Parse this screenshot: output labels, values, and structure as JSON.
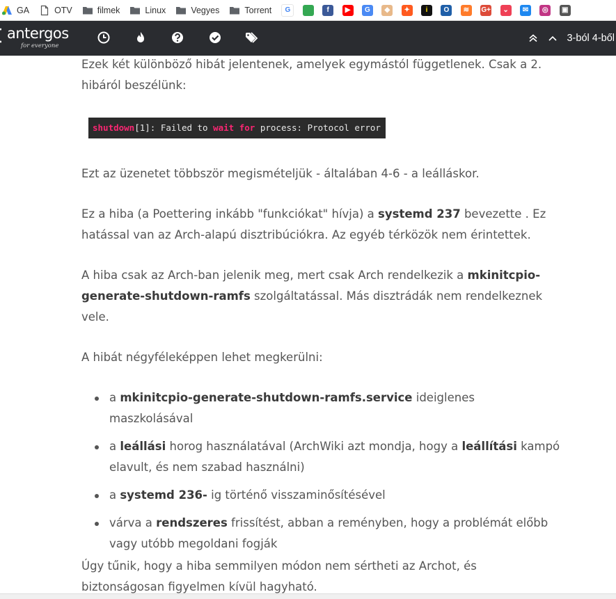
{
  "bookmarks": {
    "folders": [
      {
        "label": "GA",
        "icon": "google-ads-icon"
      },
      {
        "label": "OTV",
        "icon": "page-icon"
      },
      {
        "label": "filmek",
        "icon": "folder-icon"
      },
      {
        "label": "Linux",
        "icon": "folder-icon"
      },
      {
        "label": "Vegyes",
        "icon": "folder-icon"
      },
      {
        "label": "Torrent",
        "icon": "folder-icon"
      }
    ],
    "favicons": [
      {
        "icon": "google-icon",
        "glyph": "G",
        "color": "#ffffff",
        "text": "#4285f4"
      },
      {
        "icon": "google-maps-icon",
        "glyph": "",
        "color": "#34a853",
        "text": "#fff"
      },
      {
        "icon": "facebook-icon",
        "glyph": "f",
        "color": "#3b5998",
        "text": "#fff"
      },
      {
        "icon": "youtube-icon",
        "glyph": "▶",
        "color": "#ff0000",
        "text": "#fff"
      },
      {
        "icon": "google-translate-icon",
        "glyph": "G",
        "color": "#4a8af4",
        "text": "#fff"
      },
      {
        "icon": "package-icon",
        "glyph": "◆",
        "color": "#e8b98a",
        "text": "#fff"
      },
      {
        "icon": "rocket-icon",
        "glyph": "✦",
        "color": "#ff5a1f",
        "text": "#fff"
      },
      {
        "icon": "info-icon",
        "glyph": "i",
        "color": "#111111",
        "text": "#ffe000"
      },
      {
        "icon": "o-box-icon",
        "glyph": "O",
        "color": "#1f5fa8",
        "text": "#fff"
      },
      {
        "icon": "soundcloud-icon",
        "glyph": "≋",
        "color": "#ff7b2a",
        "text": "#fff"
      },
      {
        "icon": "google-plus-icon",
        "glyph": "G+",
        "color": "#dd4b39",
        "text": "#fff"
      },
      {
        "icon": "pocket-icon",
        "glyph": "⌄",
        "color": "#ef4056",
        "text": "#fff"
      },
      {
        "icon": "messenger-icon",
        "glyph": "✉",
        "color": "#1e88f0",
        "text": "#fff"
      },
      {
        "icon": "instagram-icon",
        "glyph": "◎",
        "color": "#c13584",
        "text": "#fff"
      },
      {
        "icon": "video-icon",
        "glyph": "▣",
        "color": "#555555",
        "text": "#fff"
      }
    ]
  },
  "nav": {
    "logo_text": "antergos",
    "logo_tagline": "for everyone",
    "icons": [
      "clock-icon",
      "fire-icon",
      "question-icon",
      "check-circle-icon",
      "tags-icon"
    ],
    "pager_text": "3-ból 4-ből"
  },
  "article": {
    "p1": "Ezek két különböző hibát jelentenek, amelyek egymástól függetlenek. Csak a 2. hibáról beszélünk:",
    "code": {
      "t1": "shutdown",
      "t2": "[1]: Failed to ",
      "t3": "wait",
      "t4": " ",
      "t5": "for",
      "t6": " process: Protocol error"
    },
    "p2": "Ezt az üzenetet többször megismételjük - általában 4-6 - a leálláskor.",
    "p3": {
      "a": "Ez a hiba (a Poettering inkább \"funkciókat\" hívja) a ",
      "b": "systemd 237",
      "c": " bevezette . Ez hatással van az Arch-alapú disztribúciókra. Az egyéb térközök nem érintettek."
    },
    "p4": {
      "a": "A hiba csak az Arch-ban jelenik meg, mert csak Arch rendelkezik a ",
      "b": "mkinitcpio-generate-shutdown-ramfs",
      "c": " szolgáltatással. Más disztrádák nem rendelkeznek vele."
    },
    "p5": "A hibát négyféleképpen lehet megkerülni:",
    "list": [
      {
        "a": "a ",
        "b": "mkinitcpio-generate-shutdown-ramfs.service",
        "c": " ideiglenes maszkolásával",
        "b2": "",
        "c2": ""
      },
      {
        "a": "a ",
        "b": "leállási",
        "c": " horog használatával (ArchWiki azt mondja, hogy a ",
        "b2": "leállítási",
        "c2": " kampó elavult, és nem szabad használni)"
      },
      {
        "a": "a ",
        "b": "systemd 236-",
        "c": " ig történő visszaminősítésével",
        "b2": "",
        "c2": ""
      },
      {
        "a": "várva a ",
        "b": "rendszeres",
        "c": " frissítést, abban a reményben, hogy a problémát előbb vagy utóbb megoldani fogják",
        "b2": "",
        "c2": ""
      }
    ],
    "p6": "Úgy tűnik, hogy a hiba semmilyen módon nem sértheti az Archot, és biztonságosan figyelmen kívül hagyható."
  }
}
